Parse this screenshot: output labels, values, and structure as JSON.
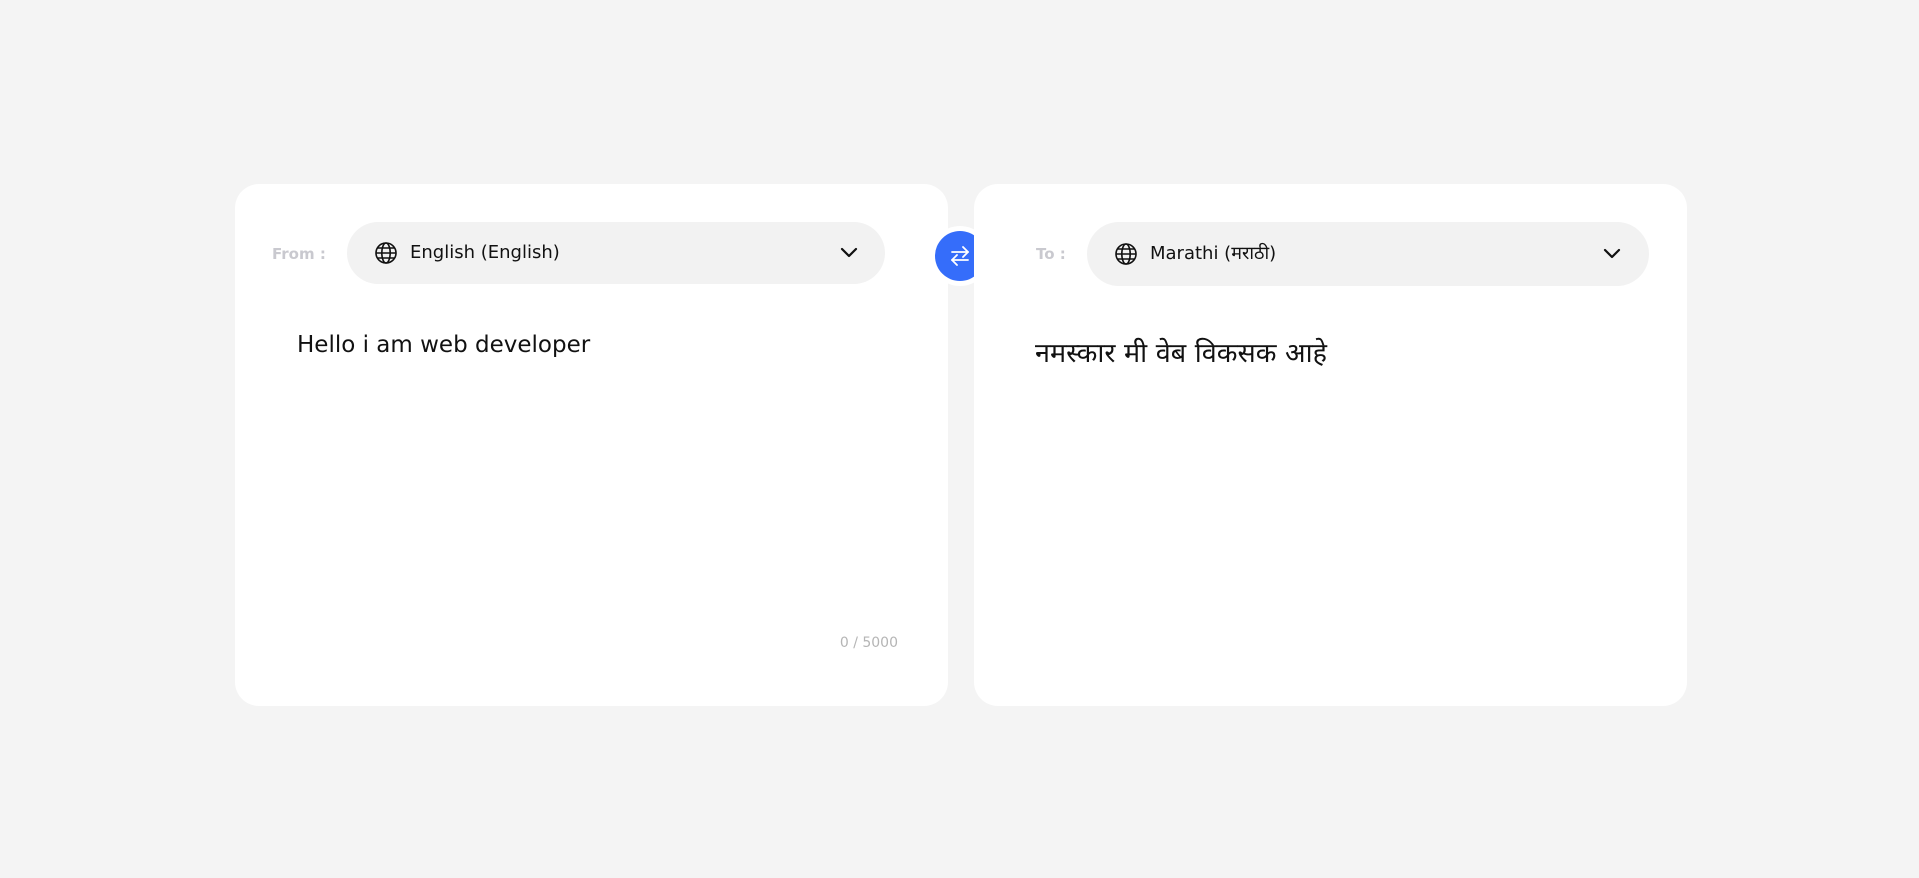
{
  "source": {
    "label": "From :",
    "language": "English (English)",
    "text": "Hello i am web developer",
    "char_count": "0 / 5000"
  },
  "target": {
    "label": "To :",
    "language": "Marathi (मराठी)",
    "text": "नमस्कार मी वेब विकसक आहे"
  },
  "icons": {
    "globe": "globe-icon",
    "chevron": "chevron-down-icon",
    "swap": "swap-arrows-icon"
  },
  "colors": {
    "background": "#f4f4f4",
    "card": "#ffffff",
    "accent": "#356dfa",
    "select_bg": "#f2f2f2",
    "muted_label": "#c9c9cf"
  }
}
